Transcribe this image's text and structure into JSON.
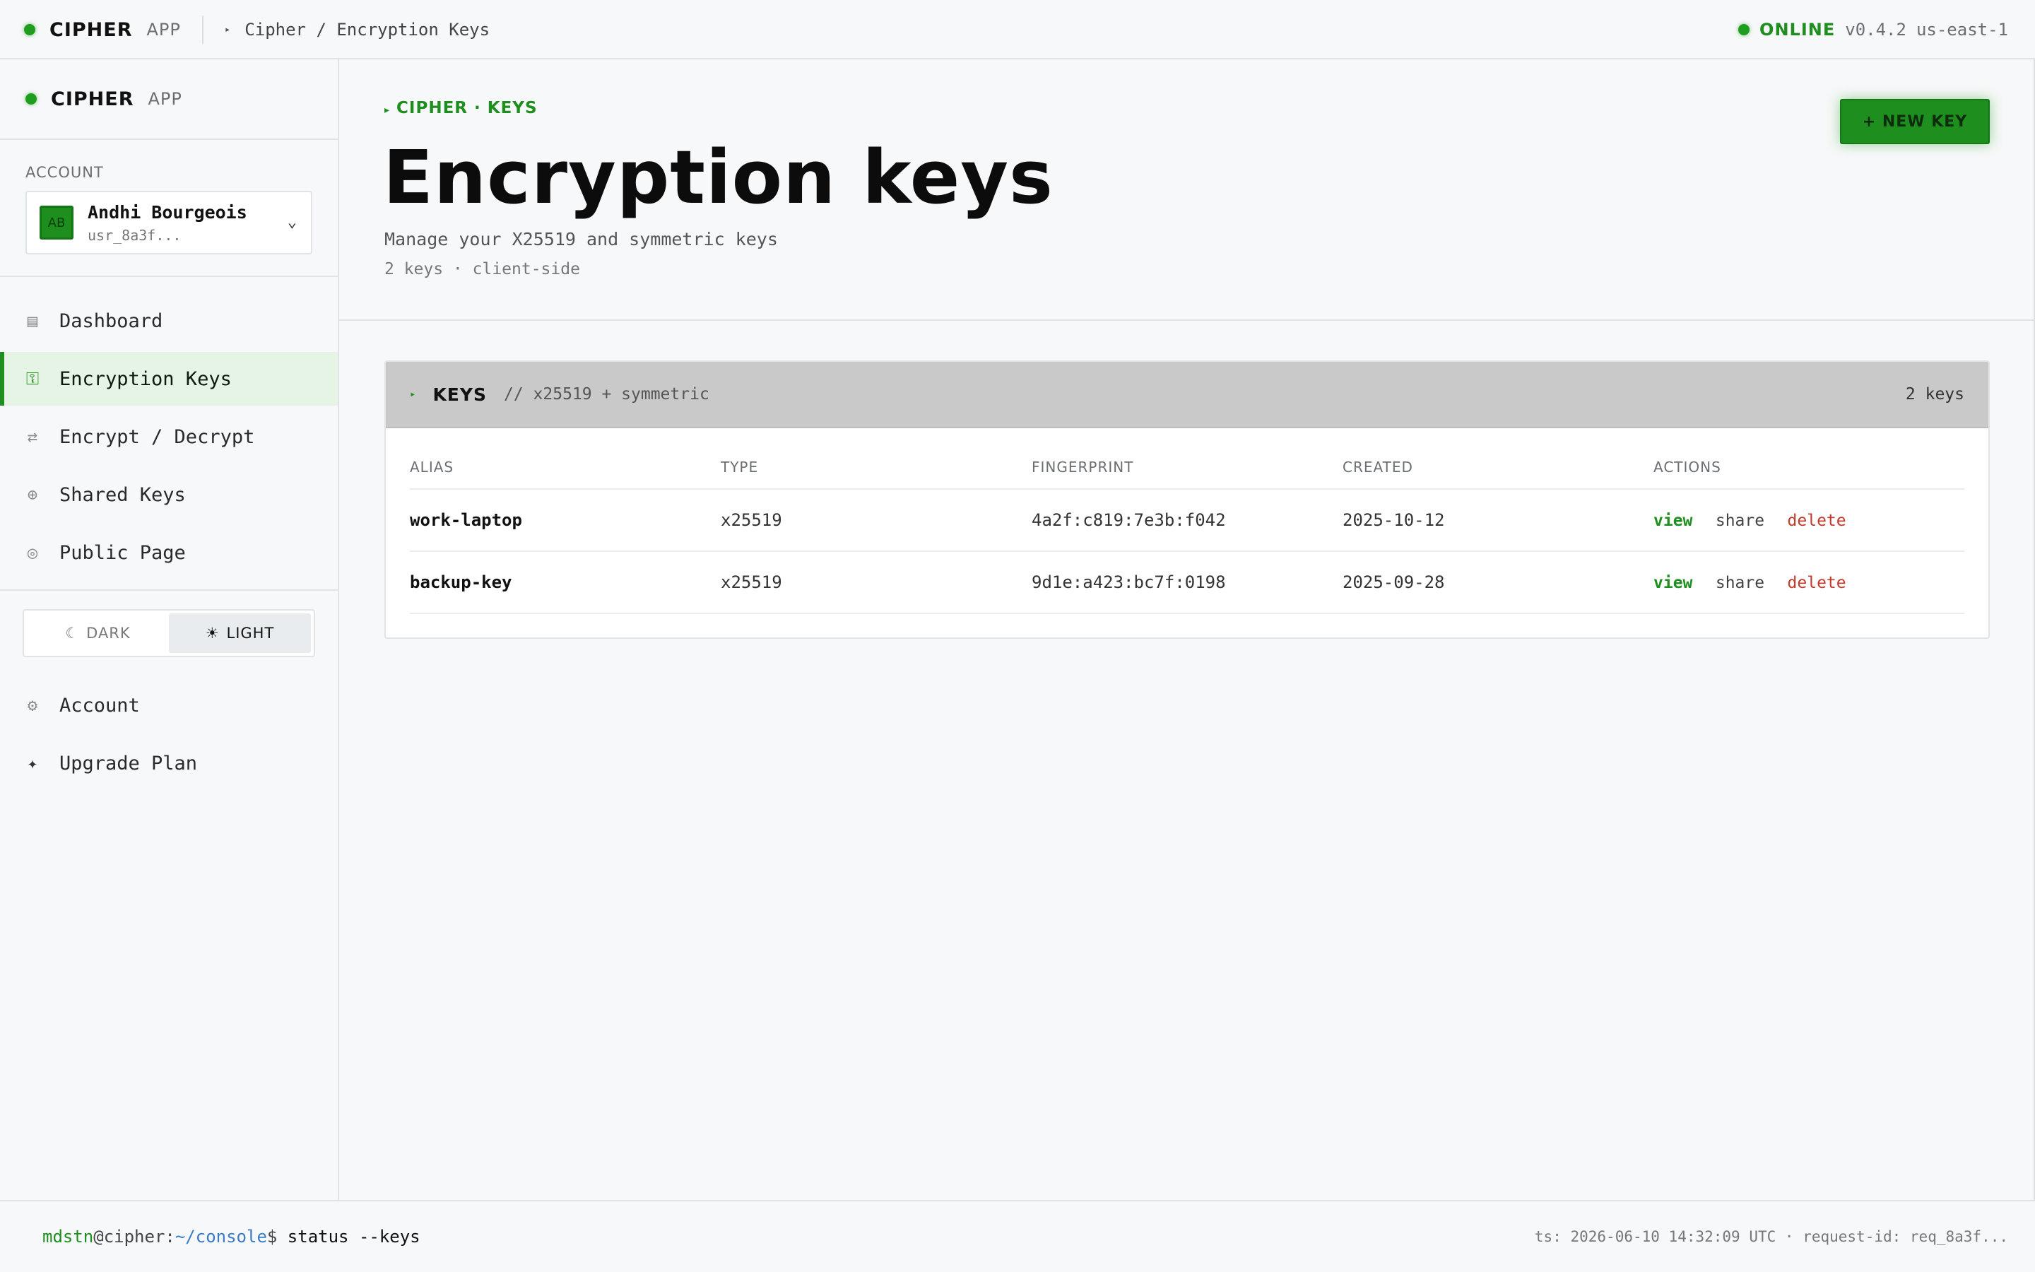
{
  "app": {
    "brand": "CIPHER",
    "brand_sub": "APP",
    "breadcrumb": "Cipher / Encryption Keys",
    "status": "ONLINE",
    "version": "v0.4.2",
    "region": "us-east-1",
    "accent_color": "#1e8f1e"
  },
  "sidebar": {
    "account_label": "ACCOUNT",
    "account": {
      "initials": "AB",
      "name": "Andhi Bourgeois",
      "id": "usr_8a3f..."
    },
    "nav": [
      {
        "label": "Dashboard",
        "icon": "grid-icon"
      },
      {
        "label": "Encryption Keys",
        "icon": "key-icon",
        "active": true
      },
      {
        "label": "Encrypt / Decrypt",
        "icon": "swap-icon"
      },
      {
        "label": "Shared Keys",
        "icon": "share-plus-icon"
      },
      {
        "label": "Public Page",
        "icon": "target-icon"
      }
    ],
    "theme": {
      "dark": "DARK",
      "light": "LIGHT",
      "selected": "LIGHT"
    },
    "bottom": [
      {
        "label": "Account",
        "icon": "gear-icon"
      },
      {
        "label": "Upgrade Plan",
        "icon": "sparkle-icon"
      }
    ]
  },
  "header": {
    "eyebrow": "CIPHER · KEYS",
    "title": "Encryption keys",
    "subtitle": "Manage your X25519 and symmetric keys",
    "meta": "2 keys · client-side",
    "new_key_label": "+ NEW KEY"
  },
  "panel": {
    "title": "KEYS",
    "subtitle": "// x25519 + symmetric",
    "count": "2 keys",
    "columns": [
      "ALIAS",
      "TYPE",
      "FINGERPRINT",
      "CREATED",
      "ACTIONS"
    ],
    "rows": [
      {
        "alias": "work-laptop",
        "type": "x25519",
        "fingerprint": "4a2f:c819:7e3b:f042",
        "created": "2025-10-12"
      },
      {
        "alias": "backup-key",
        "type": "x25519",
        "fingerprint": "9d1e:a423:bc7f:0198",
        "created": "2025-09-28"
      }
    ],
    "actions": {
      "view": "view",
      "share": "share",
      "delete": "delete"
    }
  },
  "footer": {
    "user": "mdstn",
    "host": "@cipher:",
    "path": "~/console",
    "symbol": "$",
    "command": " status --keys",
    "right": "ts: 2026-06-10 14:32:09 UTC · request-id: req_8a3f..."
  }
}
